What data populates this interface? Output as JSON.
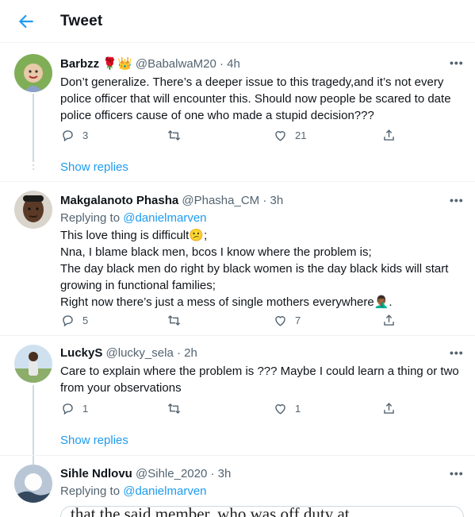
{
  "header": {
    "title": "Tweet"
  },
  "tweets": [
    {
      "name": "Barbzz",
      "name_emoji": "🌹👑",
      "handle_time": "@BabalwaM20 · 4h",
      "text": "Don’t generalize. There’s a deeper issue to this tragedy,and it’s not every police officer that will encounter this. Should now people be scared to date police officers cause of one who made a stupid decision???",
      "replies": "3",
      "retweets": "",
      "likes": "21"
    },
    {
      "name": "Makgalanoto Phasha",
      "handle_time": "@Phasha_CM · 3h",
      "reply_prefix": "Replying to ",
      "reply_handle": "@danielmarven",
      "text": "This love thing is difficult😕;\nNna, I blame black men, bcos I know where the problem is;\nThe day black men do right by black women is the day black kids will start growing in functional families;\nRight now there’s just a mess of single mothers everywhere🤦🏾‍♂️.",
      "replies": "5",
      "retweets": "",
      "likes": "7"
    },
    {
      "name": "LuckyS",
      "handle_time": "@lucky_sela · 2h",
      "text": "Care to explain where the problem is ???  Maybe I could learn a thing or two from your observations",
      "replies": "1",
      "retweets": "",
      "likes": "1"
    },
    {
      "name": "Sihle Ndlovu",
      "handle_time": "@Sihle_2020 · 3h",
      "reply_prefix": "Replying to ",
      "reply_handle": "@danielmarven",
      "media_text": "that the said member, who was off duty at"
    }
  ],
  "show_replies": "Show replies",
  "more_label": "•••",
  "colors": {
    "accent": "#1d9bf0",
    "muted": "#536471",
    "text": "#0f1419"
  },
  "icons": [
    "back-arrow-icon",
    "reply-icon",
    "retweet-icon",
    "like-icon",
    "share-icon",
    "more-icon"
  ]
}
